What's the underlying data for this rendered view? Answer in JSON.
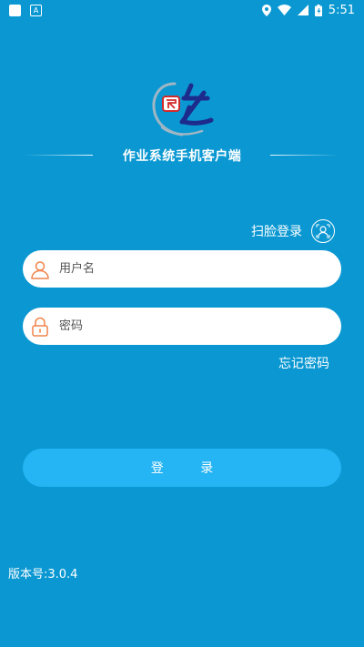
{
  "status_bar": {
    "time": "5:51"
  },
  "app": {
    "title": "作业系统手机客户端"
  },
  "face_login": {
    "label": "扫脸登录",
    "icon": "face-scan-icon"
  },
  "username": {
    "placeholder": "用户名",
    "icon": "user-icon"
  },
  "password": {
    "placeholder": "密码",
    "icon": "lock-icon"
  },
  "forgot_password": "忘记密码",
  "login_button": "登 录",
  "version": "版本号:3.0.4",
  "colors": {
    "background": "#0b98d2",
    "button": "#25b4f4",
    "icon_accent": "#f0834a"
  }
}
